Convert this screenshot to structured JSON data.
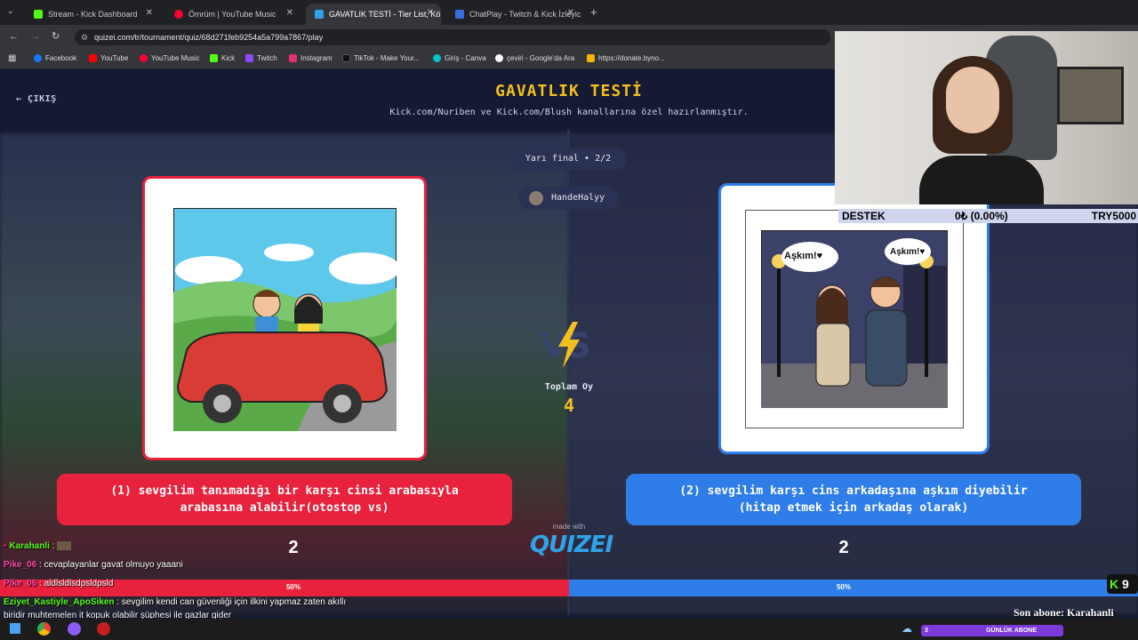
{
  "browser": {
    "tabs": [
      {
        "label": "Stream - Kick Dashboard",
        "color": "#53fc18"
      },
      {
        "label": "Ömrüm | YouTube Music",
        "color": "#ff0033"
      },
      {
        "label": "GAVATLIK TESTİ - Tier List, Kör",
        "color": "#2fa3e8"
      },
      {
        "label": "ChatPlay - Twitch & Kick İzleyic",
        "color": "#3a6de0"
      }
    ],
    "url": "quizei.com/tr/tournament/quiz/68d271feb9254a5a799a7867/play",
    "bookmarks": [
      "Facebook",
      "YouTube",
      "YouTube Music",
      "Kick",
      "Twitch",
      "Instagram",
      "TikTok - Make Your...",
      "Giriş - Canva",
      "çeviri - Google'da Ara",
      "https://donate.byno..."
    ]
  },
  "page": {
    "exit_label": "ÇIKIŞ",
    "title": "GAVATLIK TESTİ",
    "subtitle": "Kick.com/Nuriben ve Kick.com/Blush kanallarına özel hazırlanmıştır.",
    "round": "Yarı final • 2/2",
    "creator": "HandeHalyy",
    "total_label": "Toplam Oy",
    "total_value": "4",
    "made_with": "made with",
    "brand": "QUIZEI"
  },
  "options": {
    "left": {
      "text": "(1) sevgilim tanımadığı bir karşı cinsi arabasıyla arabasına alabilir(otostop vs)",
      "votes": "2",
      "percent": "50%"
    },
    "right": {
      "text": "(2) sevgilim karşı cins arkadaşına aşkım diyebilir (hitap etmek için arkadaş olarak)",
      "votes": "2",
      "percent": "50%"
    }
  },
  "image_right": {
    "bubble1": "Aşkım!♥",
    "bubble2": "Aşkım!♥"
  },
  "chat": [
    {
      "user": "Karahanli",
      "msg": "",
      "color": "#53fc18"
    },
    {
      "user": "Pike_06",
      "msg": "cevaplayanlar gavat olmuyo yaaani",
      "color": "#ff4aa8"
    },
    {
      "user": "Pike_06",
      "msg": "aldlsldlsdpsldpsld",
      "color": "#ff4aa8"
    },
    {
      "user": "Eziyet_Kastiyle_ApoSiken",
      "msg": "sevgilim kendi can güvenliği için ilkini yapmaz zaten akıllı",
      "color": "#53fc18"
    },
    {
      "user": "",
      "msg": "biridir muhtemelen it kopuk olabilir şüphesi ile gazlar gider",
      "color": "#fff"
    }
  ],
  "overlay": {
    "destek_label": "DESTEK",
    "destek_value": "0₺ (0.00%)",
    "destek_goal": "TRY5000",
    "kick_count": "9",
    "son_abone": "Son abone: Karahanli",
    "gunluk_abone": "GÜNLÜK ABONE",
    "gunluk_count": "3"
  },
  "colors": {
    "red": "#e8213c",
    "blue": "#2f7de8",
    "gold": "#f2c01d"
  }
}
